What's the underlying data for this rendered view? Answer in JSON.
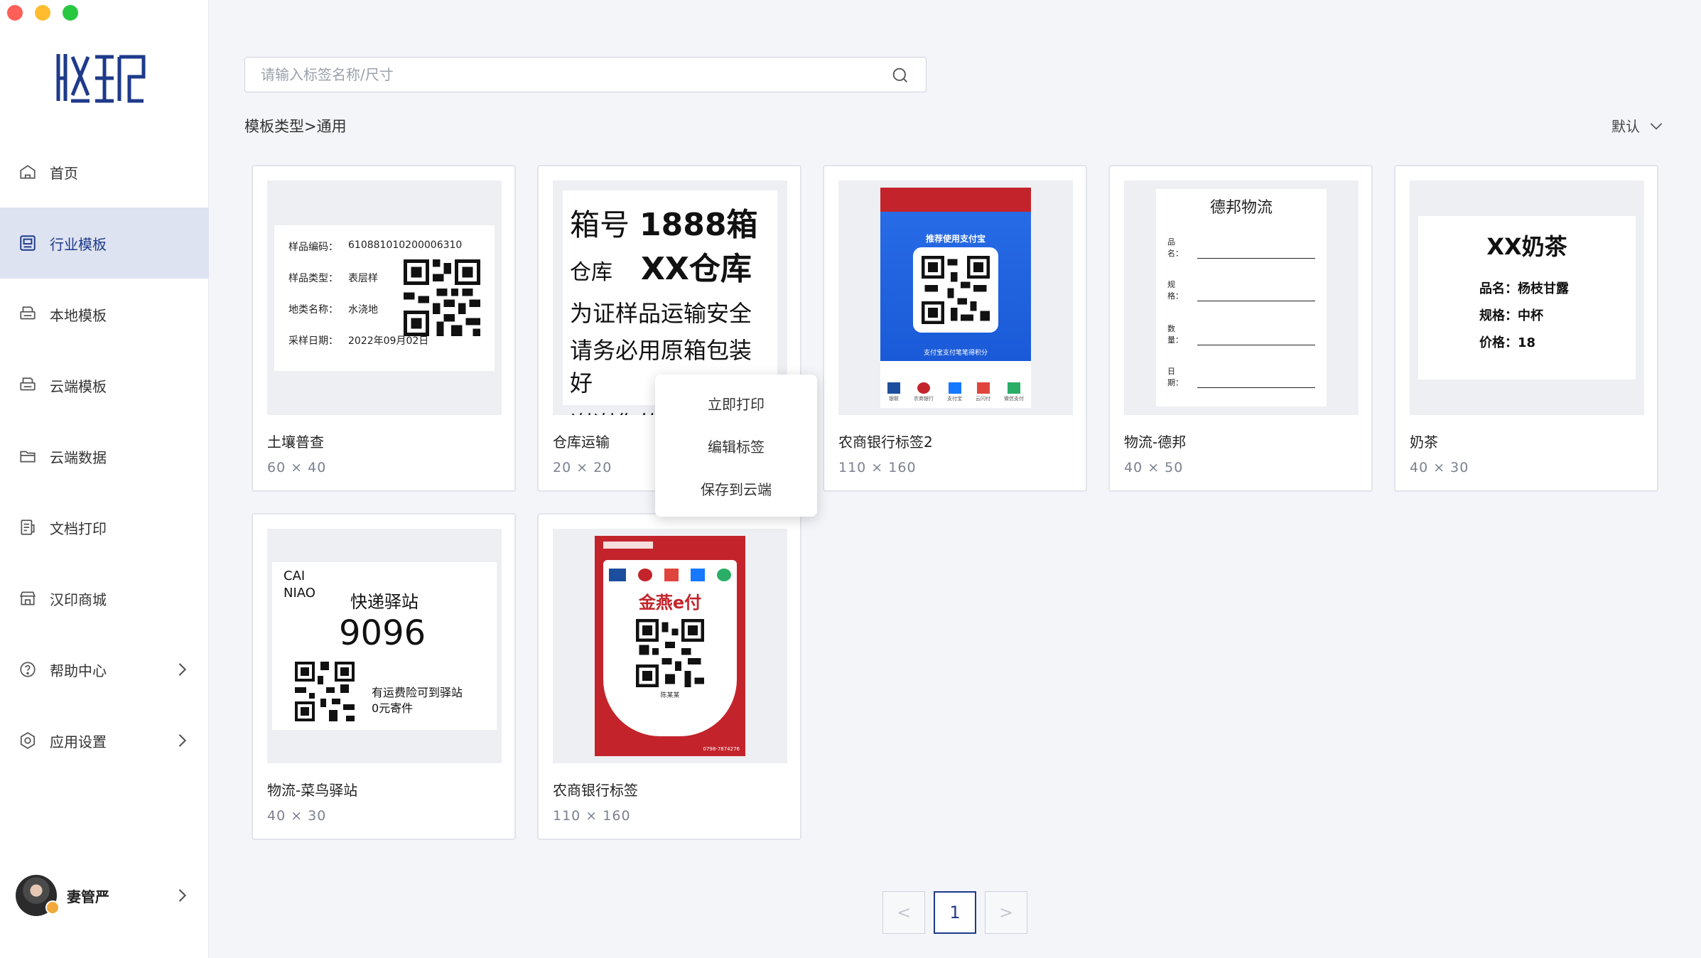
{
  "window": {
    "app_logo": "汉印"
  },
  "sidebar": {
    "items": [
      {
        "label": "首页",
        "icon": "home-icon"
      },
      {
        "label": "行业模板",
        "icon": "template-icon",
        "active": true
      },
      {
        "label": "本地模板",
        "icon": "printer-icon"
      },
      {
        "label": "云端模板",
        "icon": "printer-icon"
      },
      {
        "label": "云端数据",
        "icon": "folder-icon"
      },
      {
        "label": "文档打印",
        "icon": "document-icon"
      },
      {
        "label": "汉印商城",
        "icon": "store-icon"
      },
      {
        "label": "帮助中心",
        "icon": "help-icon",
        "has_arrow": true
      },
      {
        "label": "应用设置",
        "icon": "settings-icon",
        "has_arrow": true
      }
    ],
    "user": {
      "name": "妻管严"
    }
  },
  "search": {
    "placeholder": "请输入标签名称/尺寸",
    "value": ""
  },
  "breadcrumb": "模板类型>通用",
  "sort": {
    "label": "默认"
  },
  "cards": [
    {
      "name": "土壤普查",
      "size": "60 × 40",
      "thumb": {
        "rows": [
          [
            "样品编码：",
            "610881010200006310"
          ],
          [
            "样品类型：",
            "表层样"
          ],
          [
            "地类名称：",
            "水浇地"
          ],
          [
            "采样日期：",
            "2022年09月02日"
          ]
        ]
      }
    },
    {
      "name": "仓库运输",
      "size": "20 × 20",
      "thumb": {
        "l1a": "箱号",
        "l1b": "1888箱",
        "l2a": "仓库",
        "l2b": "XX仓库",
        "l3": "为证样品运输安全",
        "l4": "请务必用原箱包装好",
        "l5": "谢谢您的配合！"
      }
    },
    {
      "name": "农商银行标签2",
      "size": "110 × 160",
      "thumb": {
        "headline": "推荐使用支付宝",
        "footer": "支付宝支付笔笔得积分",
        "icons": [
          "银联",
          "农商银行",
          "支付宝",
          "云闪付",
          "微信支付"
        ]
      }
    },
    {
      "name": "物流-德邦",
      "size": "40 × 50",
      "thumb": {
        "title": "德邦物流",
        "fields": [
          "品名：",
          "规格：",
          "数量：",
          "日期："
        ]
      }
    },
    {
      "name": "奶茶",
      "size": "40 × 30",
      "thumb": {
        "title": "XX奶茶",
        "lines": [
          "品名：杨枝甘露",
          "规格：中杯",
          "价格：18"
        ]
      }
    },
    {
      "name": "物流-菜鸟驿站",
      "size": "40 × 30",
      "thumb": {
        "brand": "CAI NIAO",
        "title": "快递驿站",
        "number": "9096",
        "note1": "有运费险可到驿站",
        "note2": "0元寄件"
      }
    },
    {
      "name": "农商银行标签",
      "size": "110 × 160",
      "thumb": {
        "brand": "金燕e付",
        "person": "陈某某",
        "phone": "0798-7874276"
      }
    }
  ],
  "context_menu": [
    "立即打印",
    "编辑标签",
    "保存到云端"
  ],
  "pagination": {
    "prev": "<",
    "current": "1",
    "next": ">"
  },
  "colors": {
    "accent": "#1e3a8a",
    "active_bg": "#dde3f0",
    "alipay_blue": "#1677ff",
    "bank_red": "#c3242b"
  }
}
